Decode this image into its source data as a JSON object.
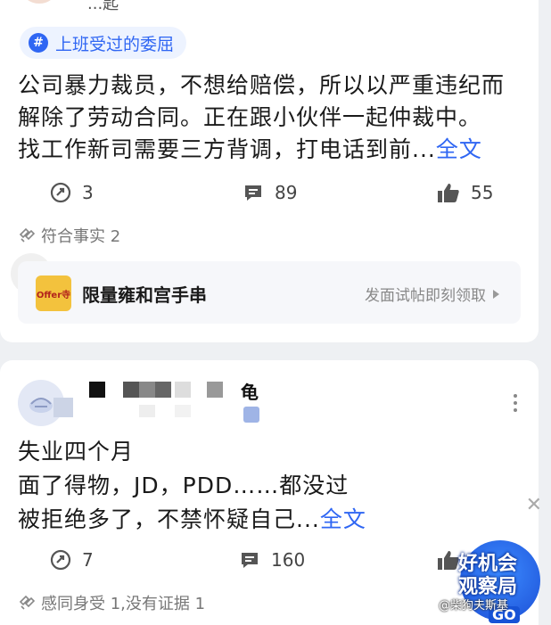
{
  "post1": {
    "author_name": "...匙",
    "topic": "上班受过的委屈",
    "text_lines": [
      "公司暴力裁员，不想给赔偿，所以以严重违纪而",
      "解除了劳动合同。正在跟小伙伴一起仲裁中。",
      "找工作新司需要三方背调，打电话到前..."
    ],
    "more_label": "全文",
    "share_count": "3",
    "comment_count": "89",
    "like_count": "55",
    "reactions": "符合事实 2",
    "promo": {
      "image_label": "Offer寺",
      "title": "限量雍和宫手串",
      "action": "发面试帖即刻领取"
    }
  },
  "post2": {
    "author_name_tail": "龟",
    "text_lines": [
      "失业四个月",
      "面了得物，JD，PDD……都没过",
      "被拒绝多了，不禁怀疑自己..."
    ],
    "more_label": "全文",
    "share_count": "7",
    "comment_count": "160",
    "reactions": "感同身受 1,没有证据 1"
  },
  "overlay": {
    "badge_line1": "好机会",
    "badge_line2": "观察局",
    "badge_go": "GO",
    "watermark": "@柴狗夫斯基"
  },
  "colors": {
    "accent": "#2f66f3",
    "background": "#eef0f3",
    "card": "#ffffff"
  }
}
